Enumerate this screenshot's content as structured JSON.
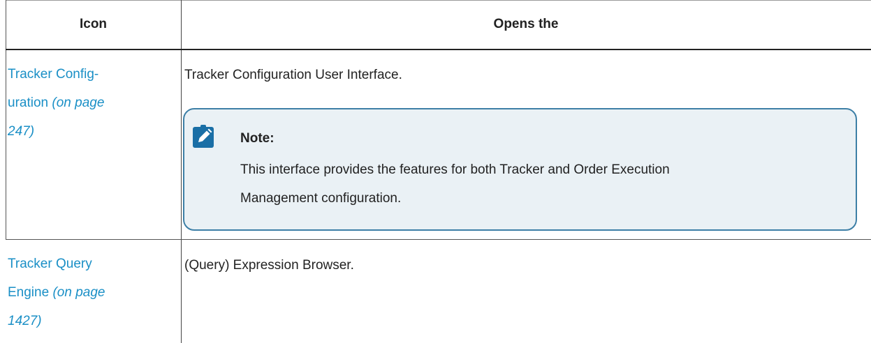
{
  "header": {
    "icon_col": "Icon",
    "opens_col": "Opens the"
  },
  "rows": [
    {
      "link": "Tracker Config-",
      "link_line2": "uration",
      "ref_line2": "(on page",
      "ref_line3": "247)",
      "opens": "Tracker Configuration User Interface."
    },
    {
      "link": "Tracker Query",
      "link_line2": "Engine",
      "ref_line2": "(on page",
      "ref_line3": "1427)",
      "opens": "(Query) Expression Browser."
    }
  ],
  "note": {
    "icon": "pencil-note-icon",
    "title": "Note:",
    "body_line1": "This interface provides the features for both Tracker and Order Execution",
    "body_line2": "Management configuration."
  },
  "colors": {
    "link": "#1a8fc6",
    "note_bg": "#eaf1f5",
    "note_border": "#3d7fa6",
    "note_icon": "#1a6fa6"
  }
}
